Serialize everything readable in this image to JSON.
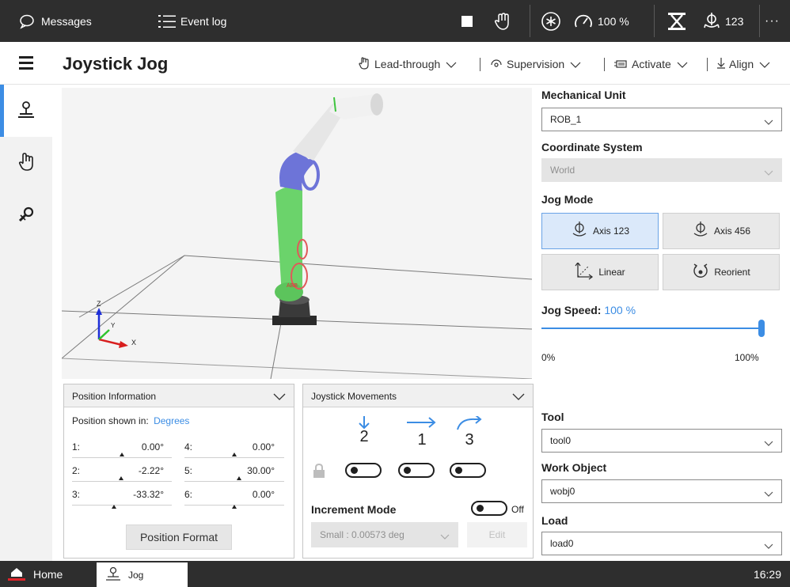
{
  "topbar": {
    "messages_label": "Messages",
    "eventlog_label": "Event log",
    "speed_label": "100 %",
    "mech_label": "123",
    "more_label": "···"
  },
  "header": {
    "title": "Joystick Jog",
    "menus": [
      {
        "label": "Lead-through"
      },
      {
        "label": "Supervision"
      },
      {
        "label": "Activate"
      },
      {
        "label": "Align"
      }
    ]
  },
  "position_panel": {
    "title": "Position Information",
    "shown_in_label": "Position shown in:",
    "shown_in_value": "Degrees",
    "axes": [
      {
        "label": "1:",
        "value": "0.00°",
        "fraction": 0.5
      },
      {
        "label": "2:",
        "value": "-2.22°",
        "fraction": 0.49
      },
      {
        "label": "3:",
        "value": "-33.32°",
        "fraction": 0.42
      },
      {
        "label": "4:",
        "value": "0.00°",
        "fraction": 0.5
      },
      {
        "label": "5:",
        "value": "30.00°",
        "fraction": 0.55
      },
      {
        "label": "6:",
        "value": "0.00°",
        "fraction": 0.5
      }
    ],
    "format_button": "Position Format"
  },
  "joystick_panel": {
    "title": "Joystick Movements",
    "directions": [
      "2",
      "1",
      "3"
    ],
    "increment_label": "Increment Mode",
    "increment_state": "Off",
    "increment_select": "Small : 0.00573 deg",
    "edit_button": "Edit"
  },
  "right": {
    "mech_unit_label": "Mechanical Unit",
    "mech_unit_value": "ROB_1",
    "coord_label": "Coordinate System",
    "coord_value": "World",
    "jog_mode_label": "Jog Mode",
    "jog_modes": [
      {
        "label": "Axis 123",
        "active": true
      },
      {
        "label": "Axis 456",
        "active": false
      },
      {
        "label": "Linear",
        "active": false
      },
      {
        "label": "Reorient",
        "active": false
      }
    ],
    "jog_speed_label": "Jog Speed:",
    "jog_speed_value": "100 %",
    "jog_speed_fraction": 1.0,
    "speed_min": "0%",
    "speed_max": "100%",
    "tool_label": "Tool",
    "tool_value": "tool0",
    "wobj_label": "Work Object",
    "wobj_value": "wobj0",
    "load_label": "Load",
    "load_value": "load0"
  },
  "view3d": {
    "axis_z": "Z",
    "axis_y": "Y",
    "axis_x": "X"
  },
  "colors": {
    "accent": "#3c8de4",
    "bar_dark": "#2e2e2e",
    "active_mode": "#dbe9fa",
    "robot_green": "#6bd36b",
    "robot_blue": "#6d74d8",
    "home_red": "#e0242a"
  },
  "bottombar": {
    "home_label": "Home",
    "jog_label": "Jog",
    "time": "16:29"
  }
}
